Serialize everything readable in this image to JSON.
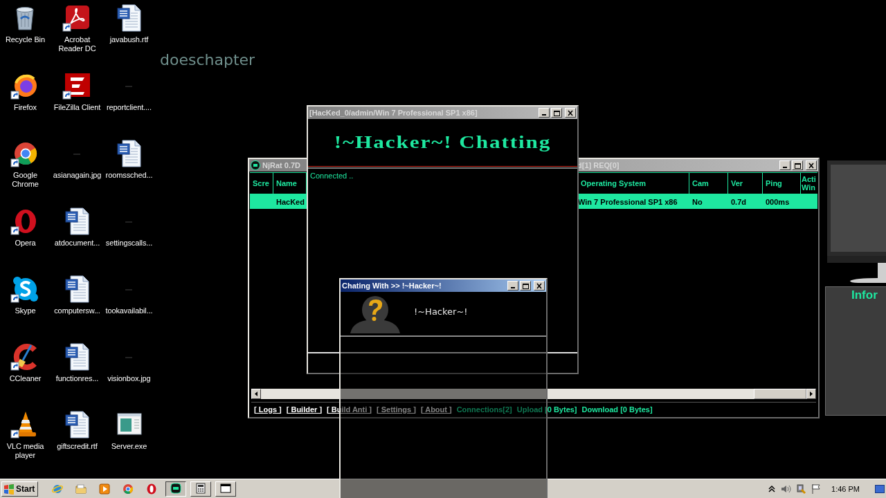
{
  "desktop": {
    "icons": [
      {
        "label": "Recycle Bin",
        "kind": "recycle",
        "shortcut": false
      },
      {
        "label": "Acrobat Reader DC",
        "kind": "acrobat",
        "shortcut": true
      },
      {
        "label": "javabush.rtf",
        "kind": "document",
        "shortcut": false
      },
      {
        "label": "Firefox",
        "kind": "firefox",
        "shortcut": true
      },
      {
        "label": "FileZilla Client",
        "kind": "filezilla",
        "shortcut": true
      },
      {
        "label": "reportclient....",
        "kind": "image",
        "shortcut": false
      },
      {
        "label": "Google Chrome",
        "kind": "chrome",
        "shortcut": true
      },
      {
        "label": "asianagain.jpg",
        "kind": "image",
        "shortcut": false
      },
      {
        "label": "roomssched...",
        "kind": "document",
        "shortcut": false
      },
      {
        "label": "Opera",
        "kind": "opera",
        "shortcut": true
      },
      {
        "label": "atdocument...",
        "kind": "document",
        "shortcut": false
      },
      {
        "label": "settingscalls...",
        "kind": "image",
        "shortcut": false
      },
      {
        "label": "Skype",
        "kind": "skype",
        "shortcut": true
      },
      {
        "label": "computersw...",
        "kind": "document",
        "shortcut": false
      },
      {
        "label": "tookavailabil...",
        "kind": "image",
        "shortcut": false
      },
      {
        "label": "CCleaner",
        "kind": "ccleaner",
        "shortcut": true
      },
      {
        "label": "functionres...",
        "kind": "document",
        "shortcut": false
      },
      {
        "label": "visionbox.jpg",
        "kind": "image",
        "shortcut": false
      },
      {
        "label": "VLC media player",
        "kind": "vlc",
        "shortcut": true
      },
      {
        "label": "giftscredit.rtf",
        "kind": "document",
        "shortcut": false
      },
      {
        "label": "Server.exe",
        "kind": "program",
        "shortcut": false
      }
    ],
    "text": "doeschapter"
  },
  "njrat_window": {
    "title_parts": [
      "NjRat 0.7D",
      "d[1] REQ[0]"
    ],
    "active": false,
    "columns": [
      "Scre",
      "Name",
      "Operating System",
      "Cam",
      "Ver",
      "Ping",
      "Acti Win"
    ],
    "rows": [
      {
        "selected": true,
        "cells": [
          "",
          "HacKed",
          "Win 7 Professional SP1 x86",
          "No",
          "0.7d",
          "000ms"
        ]
      }
    ],
    "status_items": [
      {
        "text": "[ Logs ]",
        "kind": "link"
      },
      {
        "text": "[ Builder ]",
        "kind": "link"
      },
      {
        "text": "[ Build Anti ]",
        "kind": "link"
      },
      {
        "text": "[ Settings ]",
        "kind": "link"
      },
      {
        "text": "[ About ]",
        "kind": "link"
      },
      {
        "text": "Connections[2]",
        "kind": "stat"
      },
      {
        "text": "Upload [0 Bytes]",
        "kind": "stat"
      },
      {
        "text": "Download [0 Bytes]",
        "kind": "stat"
      }
    ]
  },
  "chat_room": {
    "title": "[HacKed_0/admin/Win 7 Professional SP1 x86]",
    "active": false,
    "banner": "!~Hacker~! Chatting",
    "messages": [
      "Connected .."
    ]
  },
  "chat_with": {
    "title": "Chating With >> !~Hacker~!",
    "active": true,
    "name": "!~Hacker~!"
  },
  "side_panel": {
    "heading": "Infor"
  },
  "taskbar": {
    "start": "Start",
    "apps": [
      {
        "running": false,
        "pressed": false
      },
      {
        "running": false,
        "pressed": false
      },
      {
        "running": false,
        "pressed": false
      },
      {
        "running": false,
        "pressed": false
      },
      {
        "running": false,
        "pressed": false
      },
      {
        "running": true,
        "pressed": true
      },
      {
        "running": true,
        "pressed": false
      },
      {
        "running": true,
        "pressed": false
      }
    ],
    "clock": "1:46 PM"
  }
}
